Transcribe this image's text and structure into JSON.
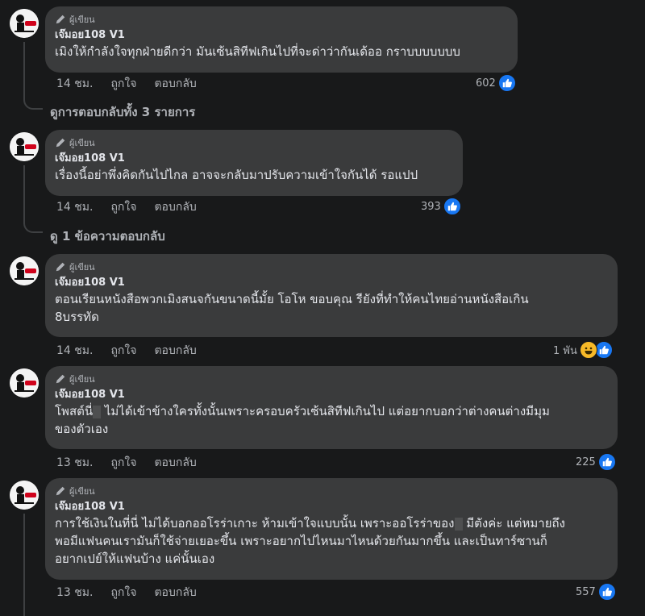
{
  "comments": [
    {
      "badge": "ผู้เขียน",
      "author": "เจ๊มอย108 V1",
      "lines": [
        "เมิงให้กำลังใจทุกฝ่ายดีกว่า มันเซ้นสิทีฟเกินไปที่จะด่าว่ากันเด้ออ กราบบบบบบบ"
      ],
      "time": "14 ชม.",
      "like": "ถูกใจ",
      "reply": "ตอบกลับ",
      "react_count": "602"
    },
    {
      "badge": "ผู้เขียน",
      "author": "เจ๊มอย108 V1",
      "lines": [
        "เรื่องนี้อย่าพึ่งคิดกันไปไกล อาจจะกลับมาปรับความเข้าใจกันได้ รอแปป"
      ],
      "time": "14 ชม.",
      "like": "ถูกใจ",
      "reply": "ตอบกลับ",
      "react_count": "393"
    },
    {
      "badge": "ผู้เขียน",
      "author": "เจ๊มอย108 V1",
      "lines": [
        "ตอนเรียนหนังสือพวกเมิงสนจกันขนาดนี้มั้ย โอโห ขอบคุณ  รียังที่ทำให้คนไทยอ่านหนังสือเกิน",
        "8บรรทัด"
      ],
      "time": "14 ชม.",
      "like": "ถูกใจ",
      "reply": "ตอบกลับ",
      "react_count": "1 พัน"
    },
    {
      "badge": "ผู้เขียน",
      "author": "เจ๊มอย108 V1",
      "line1_a": "โพสต์นี่",
      "line1_b": " ไม่ได้เข้าข้างใครทั้งนั้นเพราะครอบครัวเซ้นสิทีฟเกินไป แต่อยากบอกว่าต่างคนต่างมีมุม",
      "line2": "ของตัวเอง",
      "time": "13 ชม.",
      "like": "ถูกใจ",
      "reply": "ตอบกลับ",
      "react_count": "225"
    },
    {
      "badge": "ผู้เขียน",
      "author": "เจ๊มอย108 V1",
      "line1_a": "การใช้เงินในที่นี่ ไม่ได้บอกออโรร่าเกาะ ห้ามเข้าใจแบบนั้น เพราะออโรร่าของ",
      "line1_b": " มีตังค่ะ แต่หมายถึง",
      "line2": "พอมีแฟนคนเรามันก็ใช้จ่ายเยอะขึ้น เพราะอยากไปไหนมาไหนด้วยกันมากขึ้น และเป็นทาร์ซานก็",
      "line3": "อยากเปย์ให้แฟนบ้าง แค่นั้นเอง",
      "time": "13 ชม.",
      "like": "ถูกใจ",
      "reply": "ตอบกลับ",
      "react_count": "557"
    }
  ],
  "view_replies": [
    "ดูการตอบกลับทั้ง 3 รายการ",
    "ดู 1 ข้อความตอบกลับ"
  ],
  "colors": {
    "background": "#18191a",
    "bubble": "#3a3b3c",
    "like_blue": "#1877f2",
    "text": "#e4e6eb",
    "muted": "#b0b3b8"
  },
  "icons": [
    "pencil-icon",
    "like-icon",
    "haha-icon",
    "avatar-logo"
  ]
}
